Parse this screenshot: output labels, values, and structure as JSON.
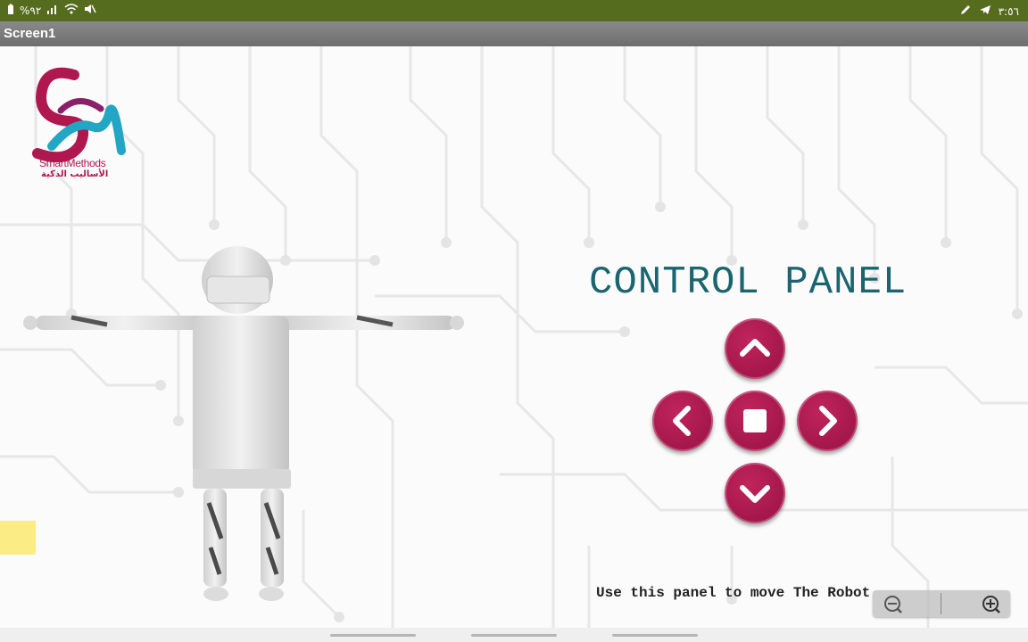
{
  "status_bar": {
    "battery_text": "%٩٢",
    "time_text": "٣:٥٦"
  },
  "app": {
    "title": "Screen1"
  },
  "logo": {
    "brand_en": "SmartMethods",
    "brand_ar": "الأساليب الذكية"
  },
  "control_panel": {
    "title": "CONTROL PANEL",
    "buttons": [
      {
        "name": "up-button",
        "icon": "chevron-up-icon"
      },
      {
        "name": "left-button",
        "icon": "chevron-left-icon"
      },
      {
        "name": "stop-button",
        "icon": "stop-icon"
      },
      {
        "name": "right-button",
        "icon": "chevron-right-icon"
      },
      {
        "name": "down-button",
        "icon": "chevron-down-icon"
      }
    ],
    "hint": "Use this panel to move The Robot"
  },
  "zoom": {
    "out_icon": "zoom-out-icon",
    "in_icon": "zoom-in-icon"
  },
  "colors": {
    "status_bar": "#556b1e",
    "title_bar": "#7c7c7c",
    "button": "#a3174b",
    "panel_title": "#1c6470"
  }
}
